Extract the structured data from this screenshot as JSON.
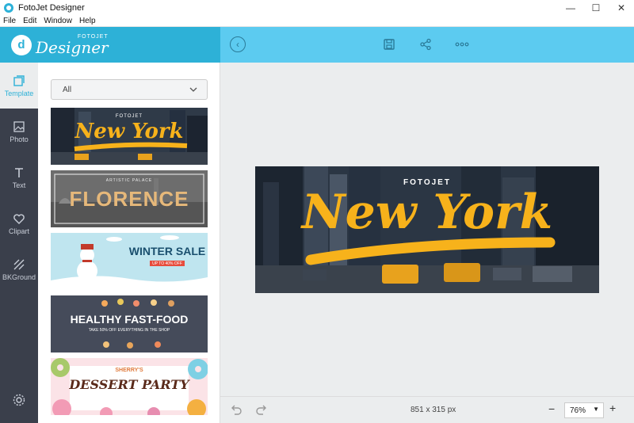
{
  "window": {
    "title": "FotoJet Designer",
    "minimize": "—",
    "maximize": "☐",
    "close": "✕"
  },
  "menu": [
    "File",
    "Edit",
    "Window",
    "Help"
  ],
  "brand": {
    "small": "FOTOJET",
    "big": "Designer",
    "mark": "d"
  },
  "toolbar": {
    "back": "‹"
  },
  "sidebar": [
    {
      "label": "Template"
    },
    {
      "label": "Photo"
    },
    {
      "label": "Text"
    },
    {
      "label": "Clipart"
    },
    {
      "label": "BKGround"
    }
  ],
  "panel": {
    "filter_value": "All",
    "templates": [
      {
        "top": "FOTOJET",
        "main": "New York"
      },
      {
        "top": "ARTISTIC PALACE",
        "main": "FLORENCE"
      },
      {
        "main": "WINTER SALE",
        "sub": "UP TO 40% OFF"
      },
      {
        "main": "HEALTHY FAST-FOOD",
        "sub": "TAKE 50% OFF  EVERYTHING IN THE SHOP"
      },
      {
        "top": "SHERRY'S",
        "main": "DESSERT PARTY"
      }
    ]
  },
  "design": {
    "top": "FOTOJET",
    "main": "New York"
  },
  "bottombar": {
    "dimensions": "851 x 315 px",
    "zoom": "76%",
    "minus": "−",
    "plus": "+"
  },
  "colors": {
    "brand": "#2db1d7",
    "toolbar": "#5ccbf0",
    "sidebar": "#3a3f4b",
    "accent": "#f7b21b"
  }
}
